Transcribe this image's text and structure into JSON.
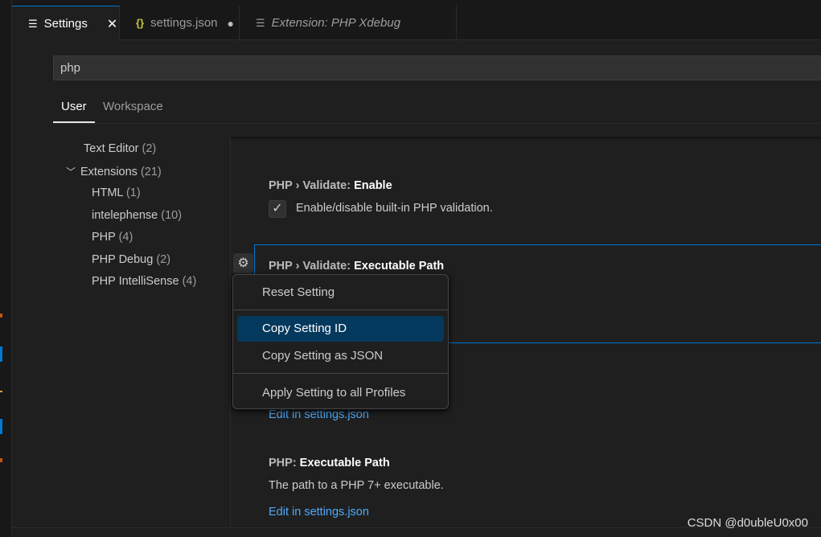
{
  "tabs": [
    {
      "label": "Settings",
      "icon": "settings-lines-icon",
      "close": "✕",
      "active": true
    },
    {
      "label": "settings.json",
      "icon": "json-braces-icon",
      "modified": "●"
    },
    {
      "label": "Extension: PHP Xdebug",
      "icon": "extension-lines-icon"
    }
  ],
  "search": {
    "value": "php"
  },
  "scope_tabs": [
    "User",
    "Workspace"
  ],
  "toc": [
    {
      "name": "Text Editor",
      "count": "(2)"
    },
    {
      "name": "Extensions",
      "count": "(21)",
      "expanded": true
    },
    {
      "name": "HTML",
      "count": "(1)"
    },
    {
      "name": "intelephense",
      "count": "(10)"
    },
    {
      "name": "PHP",
      "count": "(4)"
    },
    {
      "name": "PHP Debug",
      "count": "(2)"
    },
    {
      "name": "PHP IntelliSense",
      "count": "(4)"
    }
  ],
  "settings": [
    {
      "prefix": "PHP › Validate: ",
      "name": "Enable",
      "description": "Enable/disable built-in PHP validation.",
      "checked": true
    },
    {
      "prefix": "PHP › Validate: ",
      "name": "Executable Path",
      "link": "Edit in settings.json"
    },
    {
      "prefix": "PHP: ",
      "name": "Executable Path",
      "description": "The path to a PHP 7+ executable.",
      "link": "Edit in settings.json"
    }
  ],
  "context_menu": [
    "Reset Setting",
    "Copy Setting ID",
    "Copy Setting as JSON",
    "Apply Setting to all Profiles"
  ],
  "watermark": "CSDN @d0ubleU0x00",
  "colors": {
    "accent": "#0078d4",
    "menu_highlight": "#04395e",
    "link": "#4daafc"
  }
}
